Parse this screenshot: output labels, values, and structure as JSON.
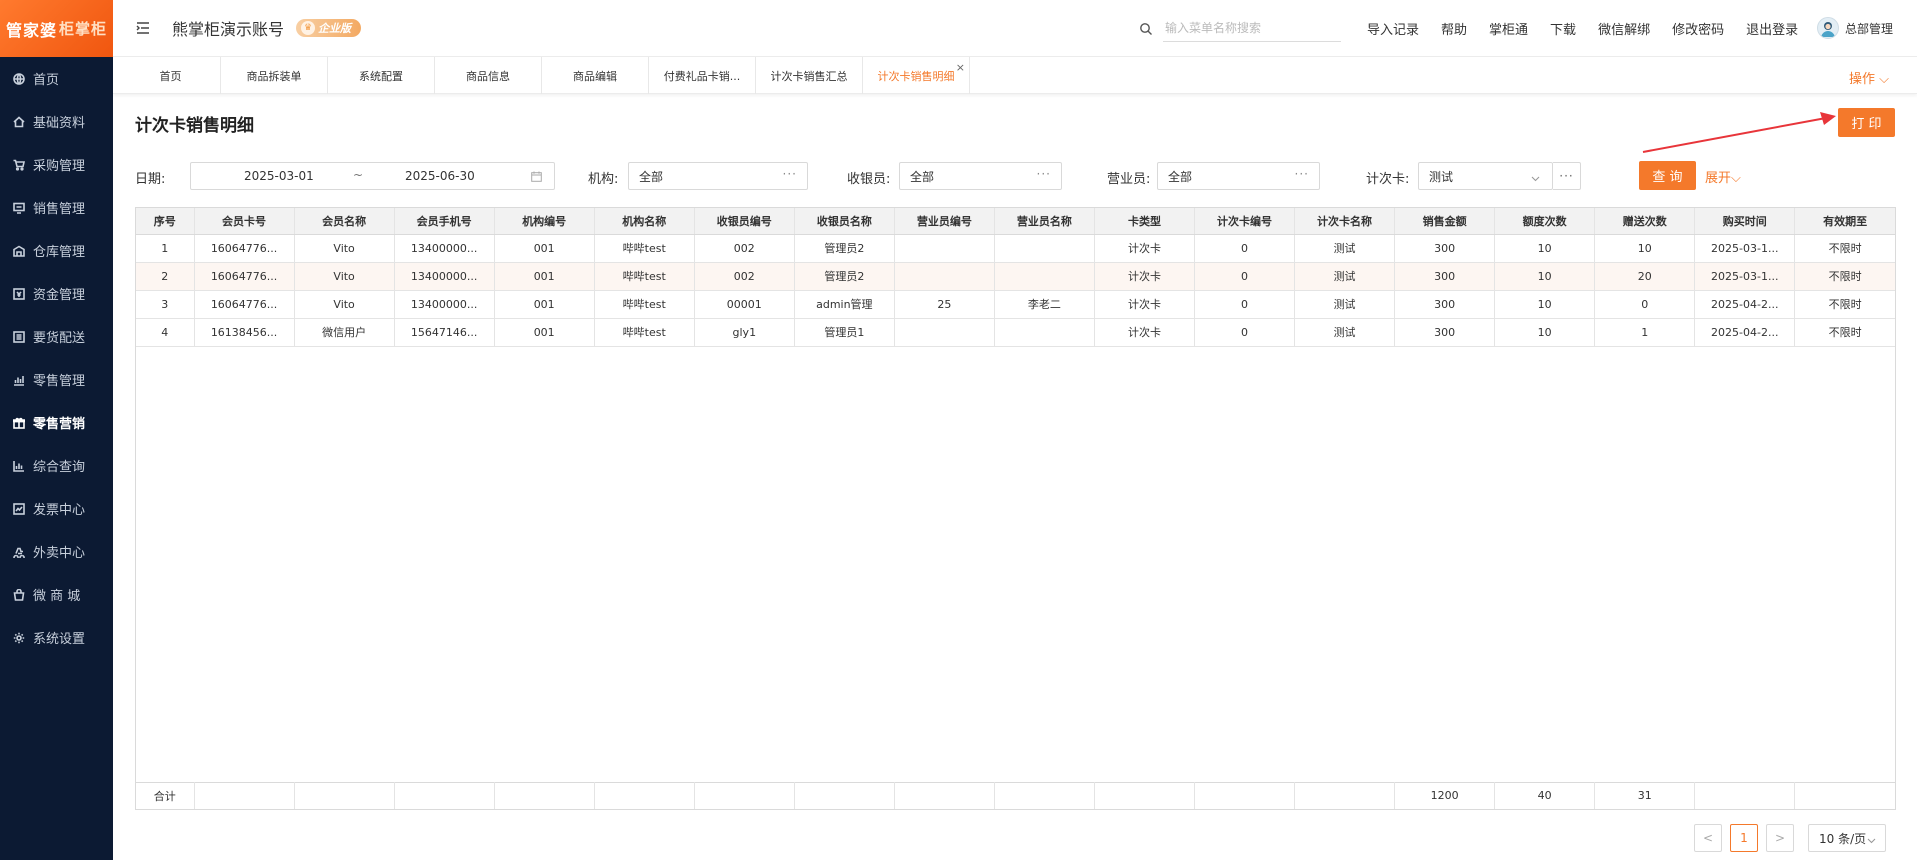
{
  "sidebar": {
    "logo_main": "管家婆",
    "logo_sub": "柜掌柜",
    "items": [
      {
        "label": "首页",
        "icon": "globe-icon"
      },
      {
        "label": "基础资料",
        "icon": "home-icon"
      },
      {
        "label": "采购管理",
        "icon": "cart-icon"
      },
      {
        "label": "销售管理",
        "icon": "monitor-icon"
      },
      {
        "label": "仓库管理",
        "icon": "warehouse-icon"
      },
      {
        "label": "资金管理",
        "icon": "money-icon"
      },
      {
        "label": "要货配送",
        "icon": "list-icon"
      },
      {
        "label": "零售管理",
        "icon": "chart-icon"
      },
      {
        "label": "零售营销",
        "icon": "gift-icon"
      },
      {
        "label": "综合查询",
        "icon": "bar-chart-icon"
      },
      {
        "label": "发票中心",
        "icon": "invoice-icon"
      },
      {
        "label": "外卖中心",
        "icon": "delivery-icon"
      },
      {
        "label": "微 商 城",
        "icon": "shop-bag-icon"
      },
      {
        "label": "系统设置",
        "icon": "gear-icon"
      }
    ],
    "active_index": 8
  },
  "header": {
    "account_name": "熊掌柜演示账号",
    "edition_badge": "企业版",
    "search_placeholder": "输入菜单名称搜索",
    "links": [
      "导入记录",
      "帮助",
      "掌柜通",
      "下载",
      "微信解绑",
      "修改密码",
      "退出登录"
    ],
    "user_name": "总部管理"
  },
  "tabs": {
    "items": [
      "首页",
      "商品拆装单",
      "系统配置",
      "商品信息",
      "商品编辑",
      "付费礼品卡销...",
      "计次卡销售汇总",
      "计次卡销售明细"
    ],
    "active_index": 7,
    "ops_label": "操作"
  },
  "page": {
    "title": "计次卡销售明细",
    "print_label": "打 印"
  },
  "filters": {
    "date_label": "日期:",
    "date_start": "2025-03-01",
    "date_sep": "~",
    "date_end": "2025-06-30",
    "org_label": "机构:",
    "org_value": "全部",
    "cashier_label": "收银员:",
    "cashier_value": "全部",
    "clerk_label": "营业员:",
    "clerk_value": "全部",
    "card_label": "计次卡:",
    "card_value": "测试",
    "query_label": "查 询",
    "expand_label": "展开"
  },
  "table": {
    "columns": [
      "序号",
      "会员卡号",
      "会员名称",
      "会员手机号",
      "机构编号",
      "机构名称",
      "收银员编号",
      "收银员名称",
      "营业员编号",
      "营业员名称",
      "卡类型",
      "计次卡编号",
      "计次卡名称",
      "销售金额",
      "额度次数",
      "赠送次数",
      "购买时间",
      "有效期至"
    ],
    "rows": [
      [
        "1",
        "16064776...",
        "Vito",
        "13400000...",
        "001",
        "哔哔test",
        "002",
        "管理员2",
        "",
        "",
        "计次卡",
        "0",
        "测试",
        "300",
        "10",
        "10",
        "2025-03-1...",
        "不限时"
      ],
      [
        "2",
        "16064776...",
        "Vito",
        "13400000...",
        "001",
        "哔哔test",
        "002",
        "管理员2",
        "",
        "",
        "计次卡",
        "0",
        "测试",
        "300",
        "10",
        "20",
        "2025-03-1...",
        "不限时"
      ],
      [
        "3",
        "16064776...",
        "Vito",
        "13400000...",
        "001",
        "哔哔test",
        "00001",
        "admin管理",
        "25",
        "李老二",
        "计次卡",
        "0",
        "测试",
        "300",
        "10",
        "0",
        "2025-04-2...",
        "不限时"
      ],
      [
        "4",
        "16138456...",
        "微信用户",
        "15647146...",
        "001",
        "哔哔test",
        "gly1",
        "管理员1",
        "",
        "",
        "计次卡",
        "0",
        "测试",
        "300",
        "10",
        "1",
        "2025-04-2...",
        "不限时"
      ]
    ],
    "footer": [
      "合计",
      "",
      "",
      "",
      "",
      "",
      "",
      "",
      "",
      "",
      "",
      "",
      "",
      "1200",
      "40",
      "31",
      "",
      ""
    ]
  },
  "pagination": {
    "prev": "<",
    "current": "1",
    "next": ">",
    "page_size": "10 条/页"
  },
  "colors": {
    "accent": "#f4792b",
    "sidebar_bg": "#0c1a33",
    "annotation": "#e8353a"
  }
}
